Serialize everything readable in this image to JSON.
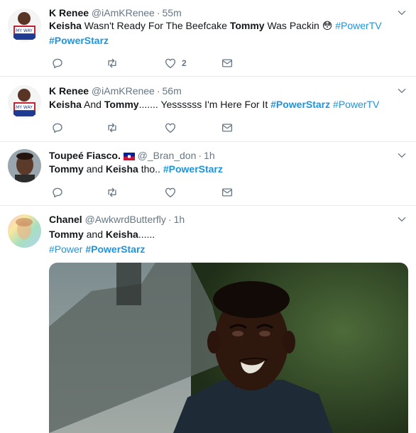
{
  "tweets": [
    {
      "name": "K Renee",
      "handle": "@iAmKRenee",
      "time": "55m",
      "text": {
        "w1": "Keisha",
        "w2": " Wasn't Ready For The Beefcake ",
        "w3": "Tommy",
        "w4": " Was Packin ",
        "emoji": "😳",
        "tag1": "#PowerTV",
        "tag2": "#PowerStarz"
      },
      "like_count": "2"
    },
    {
      "name": "K Renee",
      "handle": "@iAmKRenee",
      "time": "56m",
      "text": {
        "w1": "Keisha",
        "w2": " And ",
        "w3": "Tommy",
        "w4": "....... Yessssss I'm Here For It ",
        "tag1": "#PowerStarz",
        "tag2": "#PowerTV"
      }
    },
    {
      "name": "Toupeé Fiasco.",
      "handle": "@_Bran_don",
      "time": "1h",
      "flag_icon": "haiti-flag-icon",
      "text": {
        "w1": "Tommy",
        "w2": " and ",
        "w3": "Keisha",
        "w4": " tho.. ",
        "tag1": "#PowerStarz"
      }
    },
    {
      "name": "Chanel",
      "handle": "@AwkwrdButterfly",
      "time": "1h",
      "text": {
        "w1": "Tommy",
        "w2": " and ",
        "w3": "Keisha",
        "w4": "......",
        "tag1": "#Power",
        "tag2": "#PowerStarz"
      },
      "media": "gif-image"
    }
  ],
  "colors": {
    "link": "#1b95e0",
    "muted": "#657786",
    "border": "#e6ecf0"
  },
  "icons": [
    "reply-icon",
    "retweet-icon",
    "like-icon",
    "dm-icon",
    "caret-down-icon"
  ]
}
